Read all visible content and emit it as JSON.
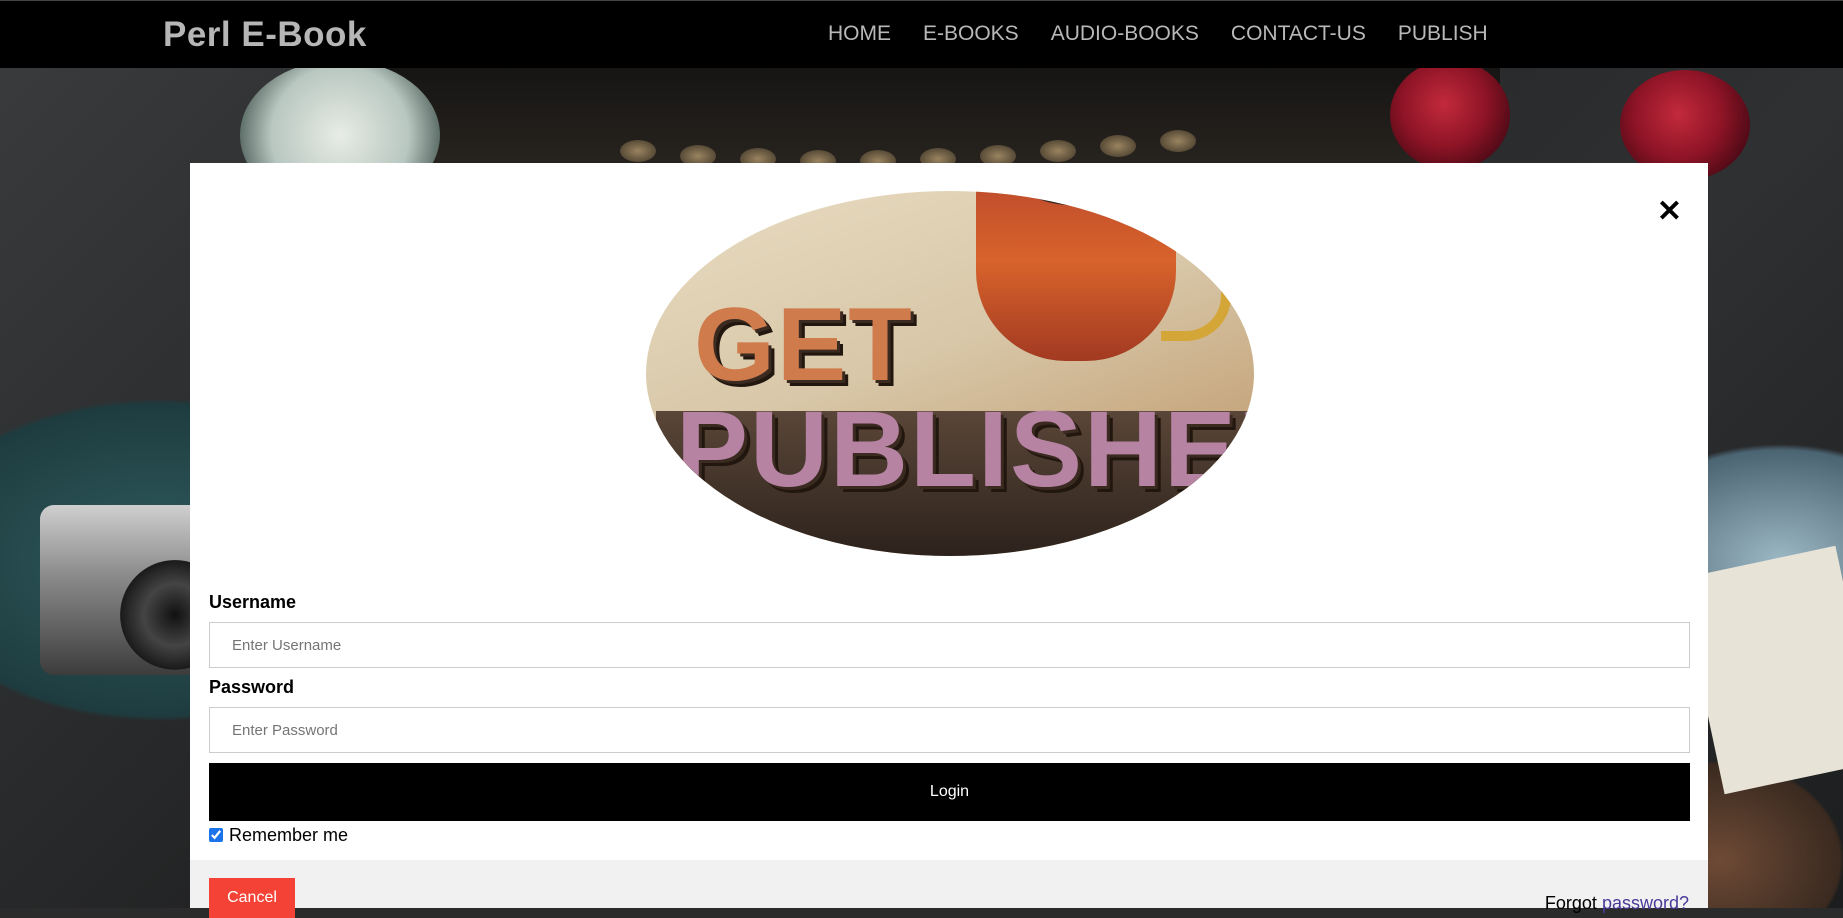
{
  "brand": "Perl E-Book",
  "nav": {
    "items": [
      {
        "label": "HOME"
      },
      {
        "label": "E-BOOKS"
      },
      {
        "label": "AUDIO-BOOKS"
      },
      {
        "label": "CONTACT-US"
      },
      {
        "label": "PUBLISH"
      }
    ]
  },
  "modal": {
    "close_symbol": "✕",
    "hero": {
      "word1": "GET",
      "word2": "PUBLISHED"
    },
    "username": {
      "label": "Username",
      "placeholder": "Enter Username",
      "value": ""
    },
    "password": {
      "label": "Password",
      "placeholder": "Enter Password",
      "value": ""
    },
    "login_label": "Login",
    "remember": {
      "label": "Remember me",
      "checked": true
    },
    "cancel_label": "Cancel",
    "forgot": {
      "prefix": "Forgot",
      "link": "password?"
    }
  },
  "colors": {
    "navbar_bg": "#000000",
    "nav_text": "#b8b8b8",
    "login_bg": "#000000",
    "cancel_bg": "#f44336",
    "footer_bg": "#f1f1f1",
    "link": "#4a3a9a"
  },
  "icons": {
    "close": "close-icon"
  }
}
